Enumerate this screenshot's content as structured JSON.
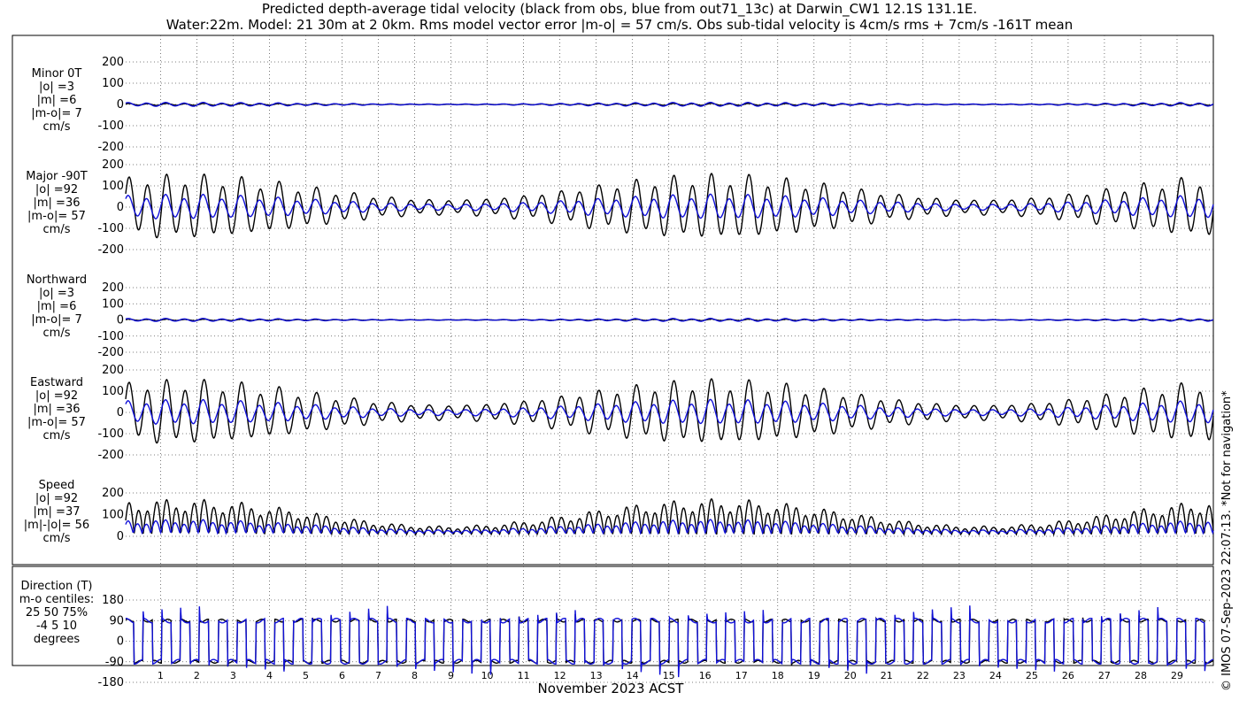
{
  "title": {
    "line1": "Predicted depth-average tidal velocity (black from obs, blue from out71_13c) at Darwin_CW1 12.1S 131.1E.",
    "line2": "Water:22m. Model: 21 30m at 2 0km. Rms model vector error |m-o| = 57 cm/s. Obs sub-tidal velocity is 4cm/s rms + 7cm/s -161T mean"
  },
  "footer": "© IMOS 07-Sep-2023 22:07:13. *Not for navigation*",
  "colors": {
    "obs": "#000000",
    "model": "#1010d8",
    "grid": "#555555"
  },
  "chart_data": {
    "type": "line",
    "xlabel": "November 2023 ACST",
    "x_ticks": [
      "1",
      "2",
      "3",
      "4",
      "5",
      "6",
      "7",
      "8",
      "9",
      "10",
      "11",
      "12",
      "13",
      "14",
      "15",
      "16",
      "17",
      "18",
      "19",
      "20",
      "21",
      "22",
      "23",
      "24",
      "25",
      "26",
      "27",
      "28",
      "29"
    ],
    "x_range_days": [
      0.04,
      30.0
    ],
    "series_names": [
      "obs",
      "model"
    ],
    "panels": [
      {
        "label_lines": [
          "Minor 0T",
          "|o| =3",
          "|m| =6",
          "|m-o|= 7",
          "cm/s"
        ],
        "ylim": [
          -200,
          200
        ],
        "yticks": [
          "200",
          "100",
          "0",
          "-100",
          "-200"
        ],
        "ytick_values": [
          200,
          100,
          0,
          -100,
          -200
        ],
        "kind": "signed",
        "obs_amplitude": 4,
        "model_amplitude": 8
      },
      {
        "label_lines": [
          "Major -90T",
          "|o| =92",
          "|m| =36",
          "|m-o|= 57",
          "cm/s"
        ],
        "ylim": [
          -200,
          200
        ],
        "yticks": [
          "200",
          "100",
          "0",
          "-100",
          "-200"
        ],
        "ytick_values": [
          200,
          100,
          0,
          -100,
          -200
        ],
        "kind": "signed",
        "obs_amplitude": 130,
        "model_amplitude": 50
      },
      {
        "label_lines": [
          "Northward",
          "|o| =3",
          "|m| =6",
          "|m-o|= 7",
          "cm/s"
        ],
        "ylim": [
          -200,
          200
        ],
        "yticks": [
          "200",
          "100",
          "0",
          "-100",
          "-200"
        ],
        "ytick_values": [
          200,
          100,
          0,
          -100,
          -200
        ],
        "kind": "signed",
        "obs_amplitude": 4,
        "model_amplitude": 8
      },
      {
        "label_lines": [
          "Eastward",
          "|o| =92",
          "|m| =36",
          "|m-o|= 57",
          "cm/s"
        ],
        "ylim": [
          -200,
          200
        ],
        "yticks": [
          "200",
          "100",
          "0",
          "-100",
          "-200"
        ],
        "ytick_values": [
          200,
          100,
          0,
          -100,
          -200
        ],
        "kind": "signed",
        "obs_amplitude": 130,
        "model_amplitude": 50
      },
      {
        "label_lines": [
          "Speed",
          "|o| =92",
          "|m| =37",
          "|m|-|o|= 56",
          "cm/s"
        ],
        "ylim": [
          0,
          200
        ],
        "yticks": [
          "200",
          "100",
          "0"
        ],
        "ytick_values": [
          200,
          100,
          0
        ],
        "kind": "speed",
        "obs_amplitude": 135,
        "model_amplitude": 52
      },
      {
        "label_lines": [
          "Direction (T)",
          "m-o centiles:",
          "25  50  75%",
          "-4   5  10",
          "degrees"
        ],
        "ylim": [
          -180,
          180
        ],
        "yticks": [
          "180",
          "90",
          "0",
          "-90",
          "-180"
        ],
        "ytick_values": [
          180,
          90,
          0,
          -90,
          -180
        ],
        "kind": "direction"
      }
    ]
  }
}
